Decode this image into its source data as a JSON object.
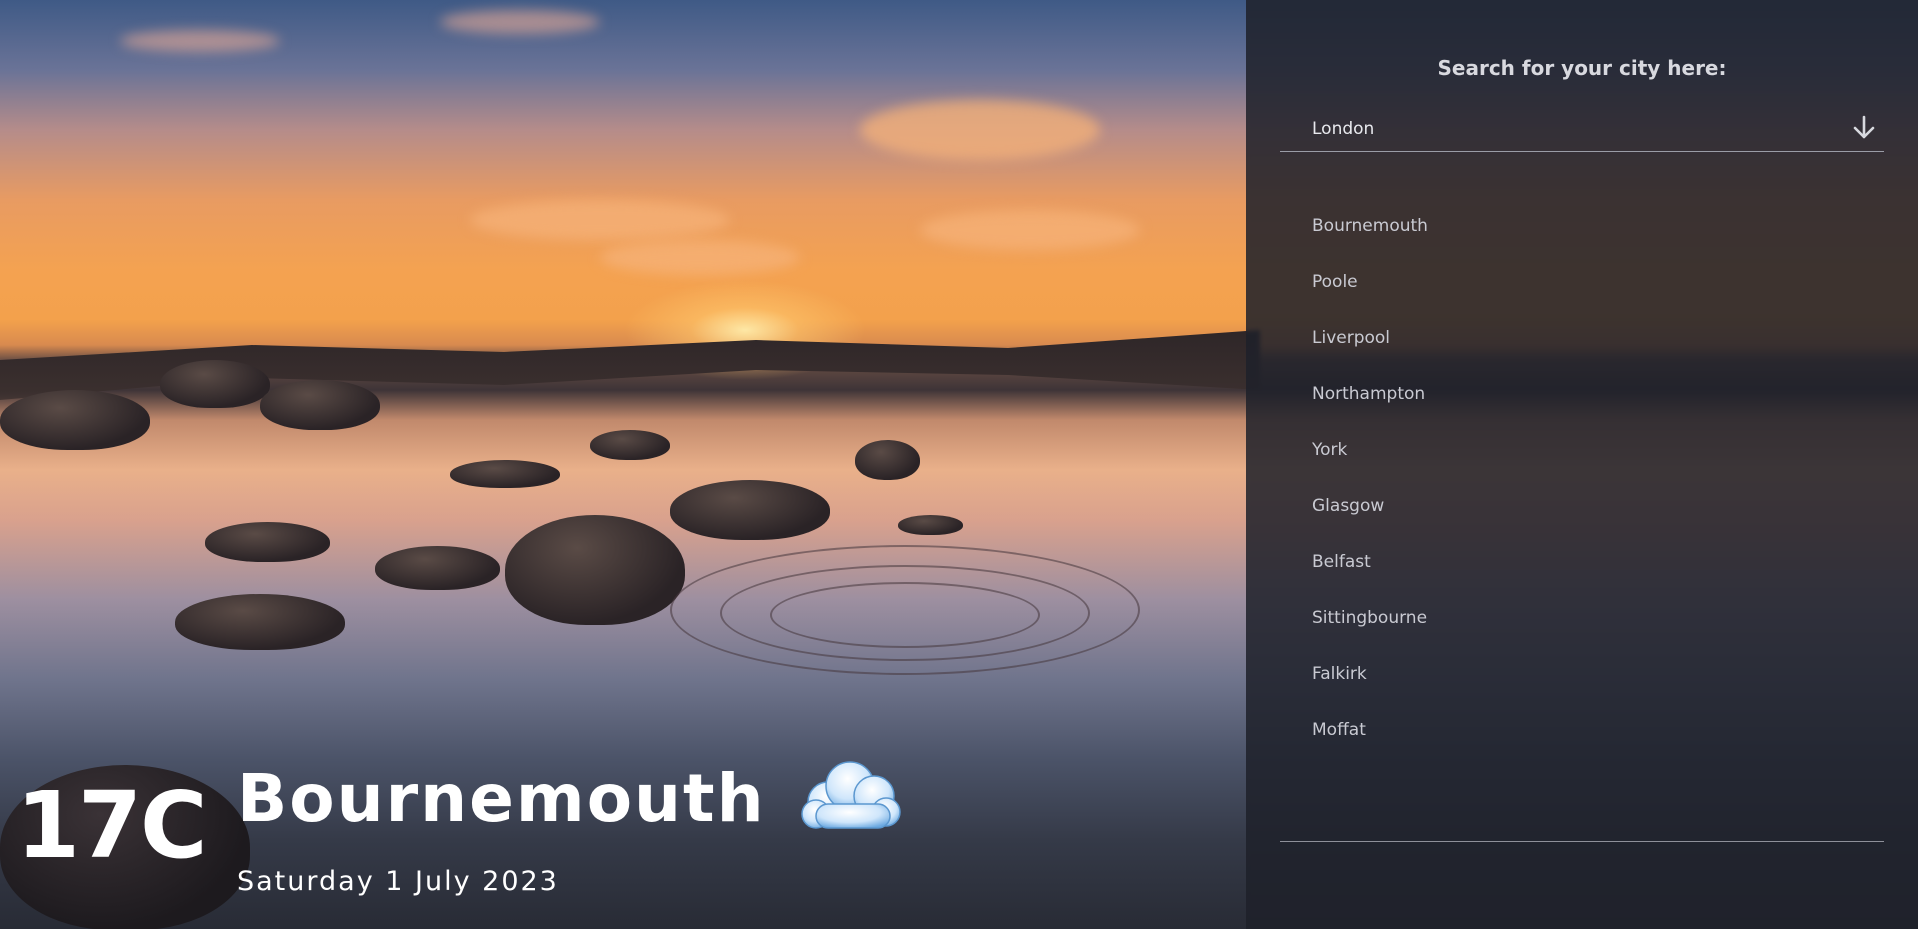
{
  "current": {
    "temperature": "17C",
    "city": "Bournemouth",
    "date": "Saturday 1 July 2023",
    "condition_icon": "cloud-icon"
  },
  "panel": {
    "title": "Search for your city here:",
    "search": {
      "value": "London",
      "button_icon": "arrow-down-icon"
    },
    "cities": [
      "Bournemouth",
      "Poole",
      "Liverpool",
      "Northampton",
      "York",
      "Glasgow",
      "Belfast",
      "Sittingbourne",
      "Falkirk",
      "Moffat"
    ]
  },
  "colors": {
    "panel_bg": "#1e212a",
    "text_primary": "#ffffff",
    "text_muted": "#c9cad2"
  }
}
